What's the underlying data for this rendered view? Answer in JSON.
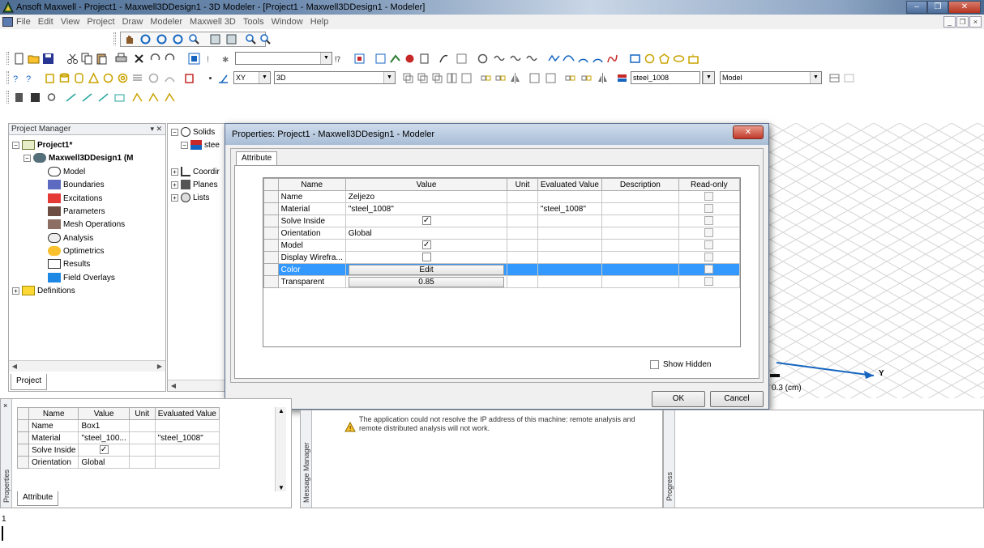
{
  "window": {
    "title": "Ansoft Maxwell  - Project1 - Maxwell3DDesign1 - 3D Modeler - [Project1 - Maxwell3DDesign1 - Modeler]",
    "minimize": "–",
    "restore": "❐",
    "close": "✕"
  },
  "menu": {
    "items": [
      "File",
      "Edit",
      "View",
      "Project",
      "Draw",
      "Modeler",
      "Maxwell 3D",
      "Tools",
      "Window",
      "Help"
    ],
    "mdi_min": "_",
    "mdi_restore": "❐",
    "mdi_close": "×"
  },
  "toolbar": {
    "plane_combo": "XY",
    "dim_combo": "3D",
    "material_combo": "steel_1008",
    "model_combo": "Model"
  },
  "project_manager": {
    "header": "Project Manager",
    "pin": "▾ ✕",
    "project": "Project1*",
    "design": "Maxwell3DDesign1 (M",
    "items": [
      "Model",
      "Boundaries",
      "Excitations",
      "Parameters",
      "Mesh Operations",
      "Analysis",
      "Optimetrics",
      "Results",
      "Field Overlays"
    ],
    "definitions": "Definitions",
    "tab": "Project"
  },
  "model_tree": {
    "solids": "Solids",
    "steel": "stee",
    "coordinates": "Coordir",
    "planes": "Planes",
    "lists": "Lists"
  },
  "viewport": {
    "axis_y": "Y",
    "scale_label": "0.3 (cm)"
  },
  "dialog": {
    "title": "Properties: Project1 - Maxwell3DDesign1 - Modeler",
    "close": "✕",
    "tab": "Attribute",
    "columns": [
      "Name",
      "Value",
      "Unit",
      "Evaluated Value",
      "Description",
      "Read-only"
    ],
    "rows": [
      {
        "name": "Name",
        "value": "Zeljezo",
        "unit": "",
        "evaluated": "",
        "description": ""
      },
      {
        "name": "Material",
        "value": "\"steel_1008\"",
        "unit": "",
        "evaluated": "\"steel_1008\"",
        "description": ""
      },
      {
        "name": "Solve Inside",
        "value": "",
        "unit": "",
        "evaluated": "",
        "description": ""
      },
      {
        "name": "Orientation",
        "value": "Global",
        "unit": "",
        "evaluated": "",
        "description": ""
      },
      {
        "name": "Model",
        "value": "",
        "unit": "",
        "evaluated": "",
        "description": ""
      },
      {
        "name": "Display Wirefra...",
        "value": "",
        "unit": "",
        "evaluated": "",
        "description": ""
      },
      {
        "name": "Color",
        "value": "Edit",
        "unit": "",
        "evaluated": "",
        "description": ""
      },
      {
        "name": "Transparent",
        "value": "0.85",
        "unit": "",
        "evaluated": "",
        "description": ""
      }
    ],
    "show_hidden": "Show Hidden",
    "ok": "OK",
    "cancel": "Cancel"
  },
  "bottom_properties": {
    "side_label": "Properties",
    "columns": [
      "Name",
      "Value",
      "Unit",
      "Evaluated Value"
    ],
    "rows": [
      {
        "name": "Name",
        "value": "Box1",
        "unit": "",
        "evaluated": ""
      },
      {
        "name": "Material",
        "value": "\"steel_100...",
        "unit": "",
        "evaluated": "\"steel_1008\""
      },
      {
        "name": "Solve Inside",
        "value": "",
        "unit": "",
        "evaluated": ""
      },
      {
        "name": "Orientation",
        "value": "Global",
        "unit": "",
        "evaluated": ""
      }
    ],
    "tab": "Attribute"
  },
  "message_manager": {
    "side_label": "Message Manager",
    "message": "The application could not resolve the IP address of this machine: remote analysis and remote distributed analysis will not work."
  },
  "progress": {
    "side_label": "Progress"
  },
  "status": {
    "text": "1"
  },
  "colors": {
    "selection": "#3399ff",
    "titlebar": "#6f8cb0"
  }
}
